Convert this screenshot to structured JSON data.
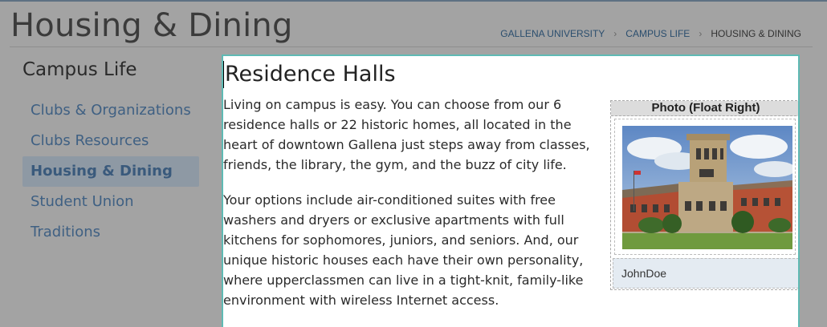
{
  "header": {
    "title": "Housing & Dining",
    "breadcrumb": {
      "items": [
        "GALLENA UNIVERSITY",
        "CAMPUS LIFE"
      ],
      "separator": "›",
      "current": "HOUSING & DINING"
    }
  },
  "sidebar": {
    "heading": "Campus Life",
    "items": [
      {
        "label": "Clubs & Organizations"
      },
      {
        "label": "Clubs Resources"
      },
      {
        "label": "Housing & Dining",
        "active": true
      },
      {
        "label": "Student Union"
      },
      {
        "label": "Traditions"
      }
    ]
  },
  "content": {
    "title": "Residence Halls",
    "paragraphs": [
      "Living on campus is easy. You can choose from our 6 residence halls or 22 historic homes, all located in the heart of downtown Gallena just steps away from classes, friends, the library, the gym, and the buzz of city life.",
      "Your options include air-conditioned suites with free washers and dryers or exclusive apartments with full kitchens for sophomores, juniors, and seniors. And, our unique historic houses each have their own personality, where upperclassmen can live in a tight-knit, family-like environment with wireless Internet access."
    ],
    "photo": {
      "label": "Photo (Float Right)",
      "caption": "JohnDoe"
    }
  },
  "colors": {
    "accent_border": "#5fbab4",
    "link": "#3f6083",
    "active_item_bg": "#8e99a4",
    "caption_bg": "#e4ebf2"
  }
}
